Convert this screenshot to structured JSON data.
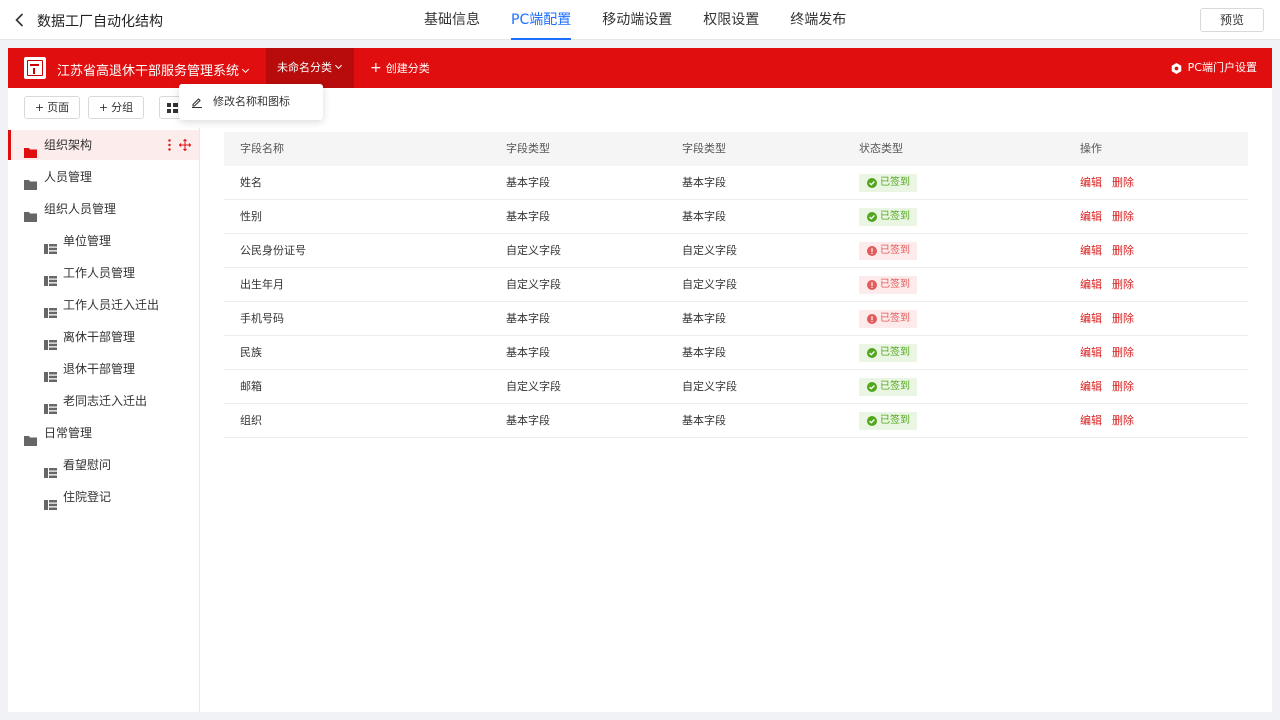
{
  "topbar": {
    "title": "数据工厂自动化结构",
    "tabs": [
      "基础信息",
      "PC端配置",
      "移动端设置",
      "权限设置",
      "终端发布"
    ],
    "active_tab": 1,
    "preview_label": "预览"
  },
  "header": {
    "system_name": "江苏省高退休干部服务管理系统",
    "category_label": "未命名分类",
    "create_label": "创建分类",
    "portal_label": "PC端门户设置"
  },
  "toolbar": {
    "add_page": "页面",
    "add_group": "分组"
  },
  "dropdown": {
    "rename_label": "修改名称和图标"
  },
  "sidebar": {
    "items": [
      {
        "label": "组织架构",
        "type": "folder",
        "level": 0,
        "active": true
      },
      {
        "label": "人员管理",
        "type": "folder",
        "level": 0
      },
      {
        "label": "组织人员管理",
        "type": "folder",
        "level": 0
      },
      {
        "label": "单位管理",
        "type": "page",
        "level": 1
      },
      {
        "label": "工作人员管理",
        "type": "page",
        "level": 1
      },
      {
        "label": "工作人员迁入迁出",
        "type": "page",
        "level": 1
      },
      {
        "label": "离休干部管理",
        "type": "page",
        "level": 1
      },
      {
        "label": "退休干部管理",
        "type": "page",
        "level": 1
      },
      {
        "label": "老同志迁入迁出",
        "type": "page",
        "level": 1
      },
      {
        "label": "日常管理",
        "type": "folder",
        "level": 0
      },
      {
        "label": "看望慰问",
        "type": "page",
        "level": 1
      },
      {
        "label": "住院登记",
        "type": "page",
        "level": 1
      }
    ]
  },
  "table": {
    "headers": [
      "字段名称",
      "字段类型",
      "字段类型",
      "状态类型",
      "操作"
    ],
    "edit_label": "编辑",
    "delete_label": "删除",
    "rows": [
      {
        "name": "姓名",
        "type1": "基本字段",
        "type2": "基本字段",
        "status": "已签到",
        "ok": true
      },
      {
        "name": "性别",
        "type1": "基本字段",
        "type2": "基本字段",
        "status": "已签到",
        "ok": true
      },
      {
        "name": "公民身份证号",
        "type1": "自定义字段",
        "type2": "自定义字段",
        "status": "已签到",
        "ok": false
      },
      {
        "name": "出生年月",
        "type1": "自定义字段",
        "type2": "自定义字段",
        "status": "已签到",
        "ok": false
      },
      {
        "name": "手机号码",
        "type1": "基本字段",
        "type2": "基本字段",
        "status": "已签到",
        "ok": false
      },
      {
        "name": "民族",
        "type1": "基本字段",
        "type2": "基本字段",
        "status": "已签到",
        "ok": true
      },
      {
        "name": "邮箱",
        "type1": "自定义字段",
        "type2": "自定义字段",
        "status": "已签到",
        "ok": true
      },
      {
        "name": "组织",
        "type1": "基本字段",
        "type2": "基本字段",
        "status": "已签到",
        "ok": true
      }
    ]
  },
  "colors": {
    "brand_red": "#e00e0e",
    "active_blue": "#1e6fff",
    "ok_green": "#52a61c",
    "warn_red": "#e25a5a"
  }
}
